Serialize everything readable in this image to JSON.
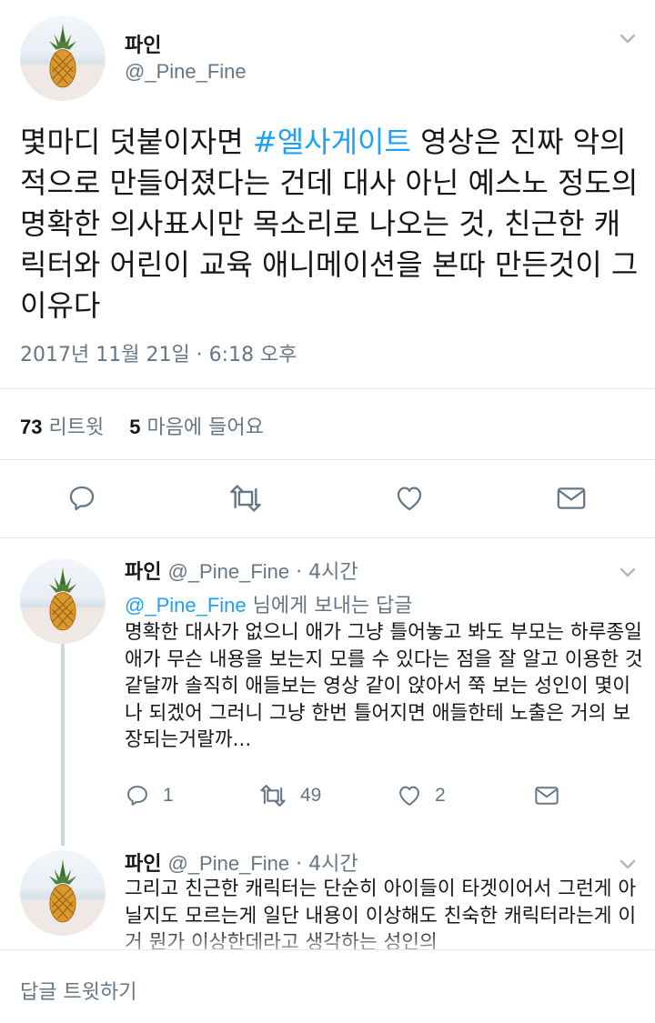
{
  "main_tweet": {
    "name": "파인",
    "handle": "@_Pine_Fine",
    "text_before": "몇마디 덧붙이자면 ",
    "hashtag": "#엘사게이트",
    "text_after": " 영상은 진짜 악의적으로 만들어졌다는 건데 대사 아닌 예스노 정도의 명확한 의사표시만 목소리로 나오는 것, 친근한 캐릭터와 어린이 교육 애니메이션을 본따 만든것이 그 이유다",
    "timestamp": "2017년 11월 21일 · 6:18 오후",
    "retweet_count": "73",
    "retweet_label": "리트윗",
    "like_count": "5",
    "like_label": "마음에 들어요"
  },
  "replies": [
    {
      "name": "파인",
      "handle": "@_Pine_Fine",
      "time": "· 4시간",
      "replying_to_mention": "@_Pine_Fine",
      "replying_to_suffix": " 님에게 보내는 답글",
      "text": "명확한 대사가 없으니 애가 그냥 틀어놓고 봐도 부모는 하루종일 애가 무슨 내용을 보는지 모를 수 있다는 점을 잘 알고 이용한 것 같달까 솔직히 애들보는 영상 같이 앉아서 쭉 보는 성인이 몇이나 되겠어 그러니 그냥 한번 틀어지면 애들한테 노출은 거의 보장되는거랄까...",
      "reply_count": "1",
      "retweet_count": "49",
      "like_count": "2"
    },
    {
      "name": "파인",
      "handle": "@_Pine_Fine",
      "time": "· 4시간",
      "text": "그리고 친근한 캐릭터는 단순히 아이들이 타겟이어서 그런게 아닐지도 모르는게 일단 내용이 이상해도 친숙한 캐릭터라는게 이거 뭔가 이상한데라고 생각하는 성인의"
    }
  ],
  "composer": {
    "placeholder": "답글 트윗하기"
  },
  "colors": {
    "accent": "#1da1f2",
    "secondary_text": "#657786",
    "separator": "#e1e8ed",
    "thread_line": "#ccd6dd"
  },
  "icons": [
    "chevron-down-icon",
    "reply-icon",
    "retweet-icon",
    "heart-icon",
    "message-icon"
  ]
}
